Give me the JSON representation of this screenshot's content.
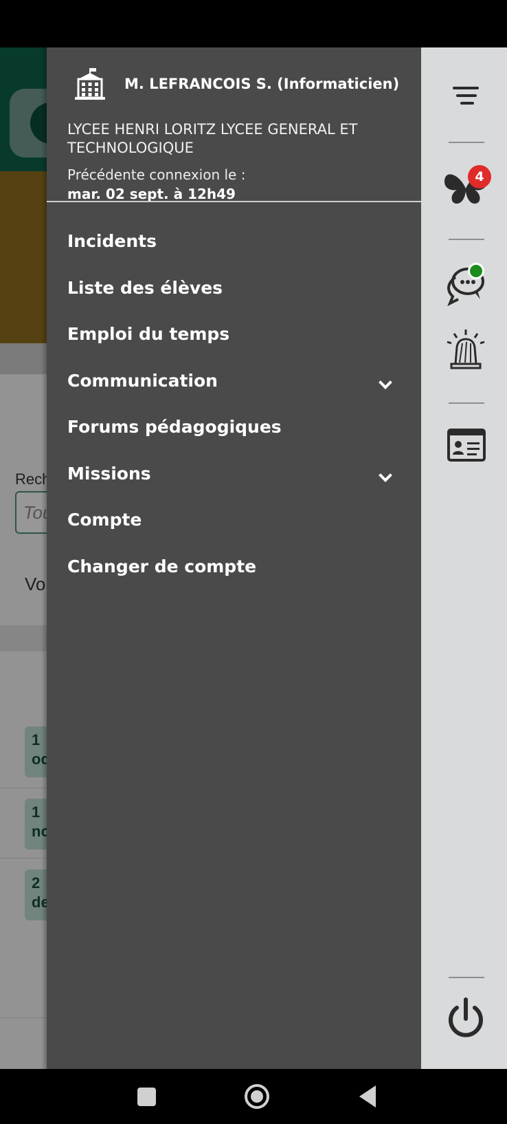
{
  "drawer": {
    "user_name": "M. LEFRANCOIS S. (Informaticien)",
    "school": "LYCEE HENRI LORITZ LYCEE GENERAL ET TECHNOLOGIQUE",
    "last_login_label": "Précédente connexion le :",
    "last_login_value": "mar. 02 sept. à 12h49",
    "menu": [
      {
        "label": "Incidents",
        "expandable": false
      },
      {
        "label": "Liste des élèves",
        "expandable": false
      },
      {
        "label": "Emploi du temps",
        "expandable": false
      },
      {
        "label": "Communication",
        "expandable": true
      },
      {
        "label": "Forums pédagogiques",
        "expandable": false
      },
      {
        "label": "Missions",
        "expandable": true
      },
      {
        "label": "Compte",
        "expandable": false
      },
      {
        "label": "Changer de compte",
        "expandable": false
      }
    ]
  },
  "rail": {
    "notification_count": "4",
    "icons": [
      "menu-icon",
      "butterfly-icon",
      "chat-icon",
      "alarm-icon",
      "id-card-icon",
      "power-icon"
    ]
  },
  "background": {
    "search_label": "Rech",
    "search_placeholder": "Tou",
    "vo_text": "Vo",
    "chips": [
      "1\nod",
      "1\nno",
      "2\nde"
    ]
  },
  "colors": {
    "drawer": "#4a4a4a",
    "rail": "#d9dadc",
    "badge": "#e02b2b",
    "online": "#1a8d1a",
    "header_green": "#0e5d4a"
  }
}
